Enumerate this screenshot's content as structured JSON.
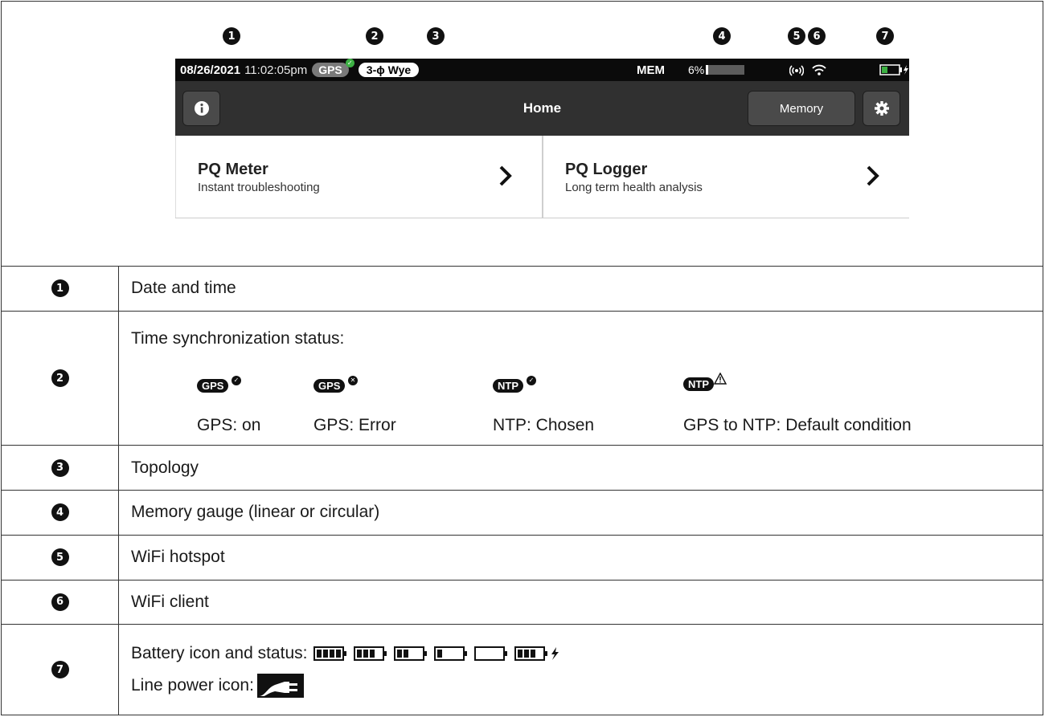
{
  "callouts": [
    "1",
    "2",
    "3",
    "4",
    "5",
    "6",
    "7"
  ],
  "device": {
    "status": {
      "date": "08/26/2021",
      "time": "11:02:05pm",
      "gps_label": "GPS",
      "topology": "3-ϕ Wye",
      "mem_label": "MEM",
      "mem_percent": "6%",
      "mem_fill_fraction": 0.06
    },
    "header": {
      "title": "Home",
      "memory_button": "Memory"
    },
    "cards": [
      {
        "title": "PQ Meter",
        "subtitle": "Instant troubleshooting"
      },
      {
        "title": "PQ Logger",
        "subtitle": "Long term health analysis"
      }
    ]
  },
  "rows": {
    "date_time": "Date and time",
    "time_sync": {
      "title": "Time synchronization status:",
      "items": [
        {
          "pill": "GPS",
          "label": "GPS: on"
        },
        {
          "pill": "GPS",
          "label": "GPS: Error"
        },
        {
          "pill": "NTP",
          "label": "NTP: Chosen"
        },
        {
          "pill": "NTP",
          "label": "GPS to NTP: Default condition"
        }
      ]
    },
    "topology": "Topology",
    "memory_gauge": "Memory gauge (linear or circular)",
    "wifi_hotspot": "WiFi hotspot",
    "wifi_client": "WiFi client",
    "battery_label": "Battery icon and status:",
    "battery_levels": [
      4,
      3,
      2,
      1,
      0,
      3
    ],
    "line_power_label": "Line power icon:"
  },
  "colors": {
    "status_bar": "#0b0b0b",
    "header_bar": "#303030",
    "gps_pill": "#7a7a7a",
    "gps_ok": "#3cb043",
    "battery_charge": "#3cb043"
  }
}
